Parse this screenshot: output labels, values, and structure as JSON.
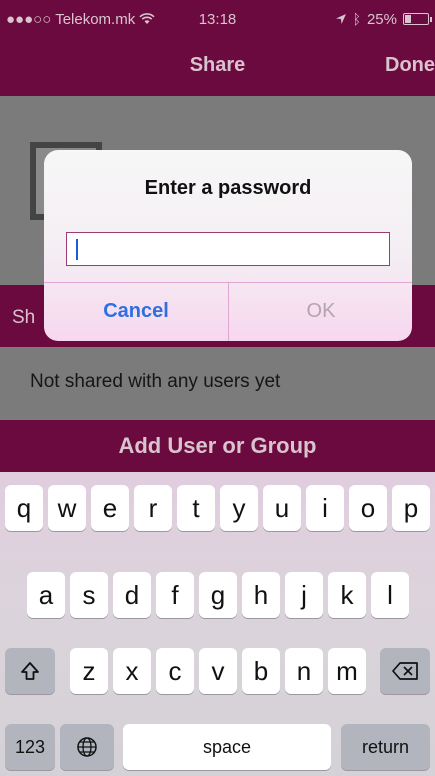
{
  "statusbar": {
    "carrier": "●●●○○ Telekom.mk",
    "time": "13:18",
    "battery": "25%",
    "battery_level": 0.25
  },
  "navbar": {
    "title": "Share",
    "done": "Done"
  },
  "background": {
    "shared_header": "Sh",
    "not_shared": "Not shared with any users yet",
    "add_user": "Add User or Group"
  },
  "alert": {
    "title": "Enter a password",
    "password_value": "",
    "cancel": "Cancel",
    "ok": "OK"
  },
  "keyboard": {
    "row1": [
      "q",
      "w",
      "e",
      "r",
      "t",
      "y",
      "u",
      "i",
      "o",
      "p"
    ],
    "row2": [
      "a",
      "s",
      "d",
      "f",
      "g",
      "h",
      "j",
      "k",
      "l"
    ],
    "row3": [
      "z",
      "x",
      "c",
      "v",
      "b",
      "n",
      "m"
    ],
    "shift_icon": "shift-icon",
    "backspace_icon": "backspace-icon",
    "numbers": "123",
    "globe_icon": "globe-icon",
    "space": "space",
    "return": "return"
  }
}
